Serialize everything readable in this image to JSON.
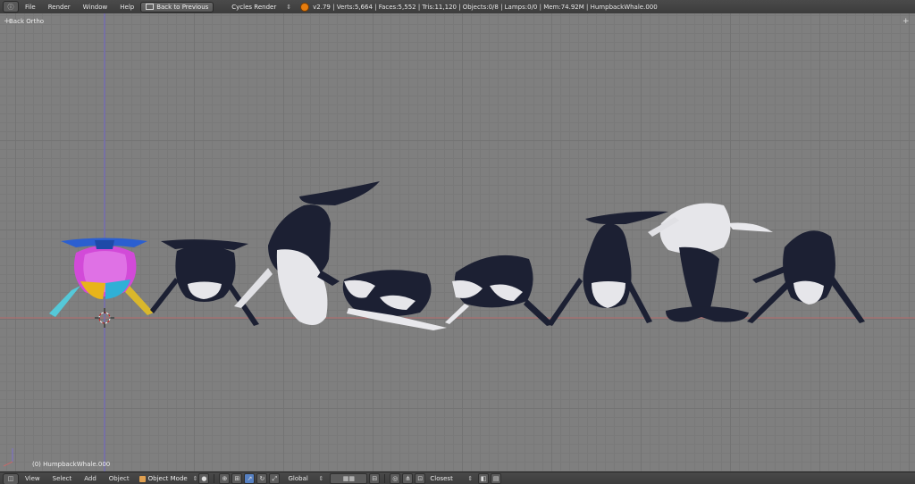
{
  "header": {
    "editor_icon": "info-editor-icon",
    "menus": [
      "File",
      "Render",
      "Window",
      "Help"
    ],
    "back_button": "Back to Previous",
    "render_engine": "Cycles Render",
    "stats": "v2.79 | Verts:5,664 | Faces:5,552 | Tris:11,120 | Objects:0/8 | Lamps:0/0 | Mem:74.92M | HumpbackWhale.000"
  },
  "viewport": {
    "view_name": "Back Ortho",
    "active_object": "(0) HumpbackWhale.000"
  },
  "footer": {
    "menus": [
      "View",
      "Select",
      "Add",
      "Object"
    ],
    "mode": "Object Mode",
    "orientation": "Global",
    "snap_target": "Closest"
  },
  "colors": {
    "whale_dark": "#1c2033",
    "whale_light": "#e8e8ec",
    "x_axis": "#c46a6a",
    "z_axis": "#7c6fd0"
  }
}
